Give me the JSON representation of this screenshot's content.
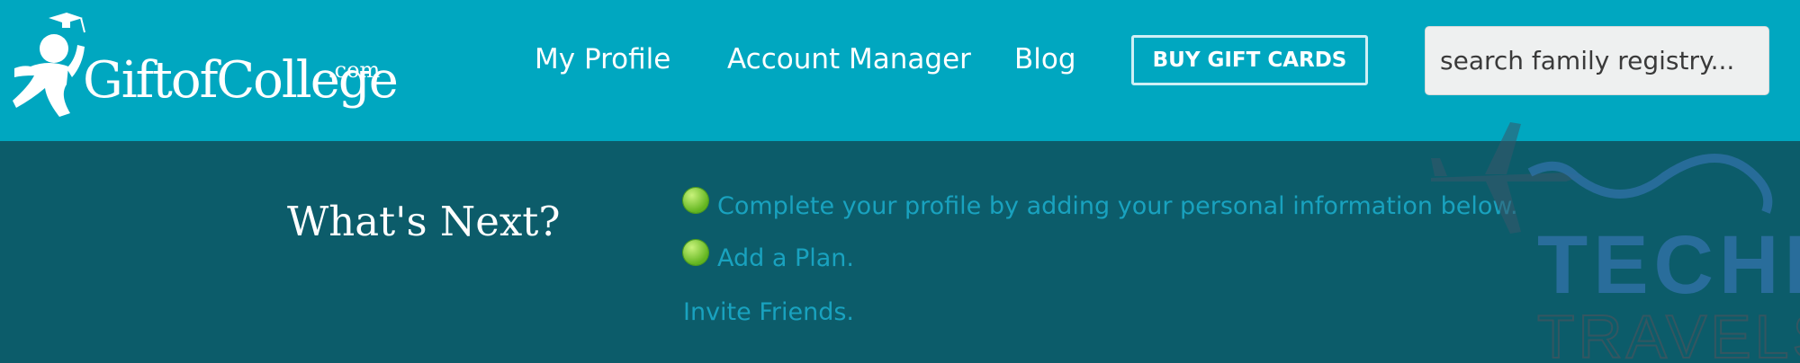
{
  "brand": {
    "name": "GiftofCollege",
    "tld": ".com"
  },
  "nav": {
    "profile": "My Profile",
    "account": "Account Manager",
    "blog": "Blog",
    "gift_button": "BUY GIFT CARDS"
  },
  "search": {
    "placeholder": "search family registry..."
  },
  "main": {
    "heading": "What's Next?",
    "tasks": [
      {
        "label": "Complete your profile by adding your personal information below.",
        "completed": true
      },
      {
        "label": "Add a Plan.",
        "completed": true
      },
      {
        "label": "Invite Friends.",
        "completed": false
      }
    ]
  },
  "watermark": {
    "line1": "TECHIE",
    "line2": "TRAVELS"
  },
  "colors": {
    "header_bg": "#00a7c0",
    "body_bg": "#0c5c6a",
    "link": "#19a2bf",
    "check": "#62b51f"
  }
}
